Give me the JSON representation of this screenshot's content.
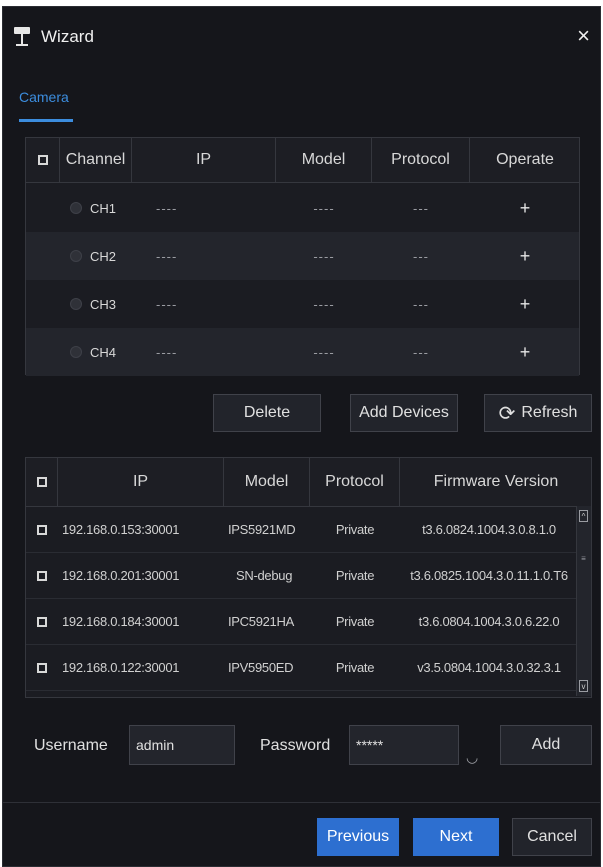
{
  "window": {
    "title": "Wizard",
    "close_label": "×"
  },
  "tab": {
    "label": "Camera"
  },
  "channels": {
    "headers": [
      "Channel",
      "IP",
      "Model",
      "Protocol",
      "Operate"
    ],
    "rows": [
      {
        "channel": "CH1",
        "ip": "----",
        "model": "----",
        "protocol": "---",
        "operate": "+"
      },
      {
        "channel": "CH2",
        "ip": "----",
        "model": "----",
        "protocol": "---",
        "operate": "+"
      },
      {
        "channel": "CH3",
        "ip": "----",
        "model": "----",
        "protocol": "---",
        "operate": "+"
      },
      {
        "channel": "CH4",
        "ip": "----",
        "model": "----",
        "protocol": "---",
        "operate": "+"
      }
    ]
  },
  "actions": {
    "delete": "Delete",
    "add_devices": "Add Devices",
    "refresh": "Refresh"
  },
  "devices": {
    "headers": [
      "IP",
      "Model",
      "Protocol",
      "Firmware Version"
    ],
    "rows": [
      {
        "ip": "192.168.0.153:30001",
        "model": "IPS5921MD",
        "protocol": "Private",
        "firmware": "t3.6.0824.1004.3.0.8.1.0"
      },
      {
        "ip": "192.168.0.201:30001",
        "model": "SN-debug",
        "protocol": "Private",
        "firmware": "t3.6.0825.1004.3.0.11.1.0.T6"
      },
      {
        "ip": "192.168.0.184:30001",
        "model": "IPC5921HA",
        "protocol": "Private",
        "firmware": "t3.6.0804.1004.3.0.6.22.0"
      },
      {
        "ip": "192.168.0.122:30001",
        "model": "IPV5950ED",
        "protocol": "Private",
        "firmware": "v3.5.0804.1004.3.0.32.3.1"
      }
    ]
  },
  "credentials": {
    "username_label": "Username",
    "username_value": "admin",
    "password_label": "Password",
    "password_value": "*****",
    "add": "Add"
  },
  "footer": {
    "previous": "Previous",
    "next": "Next",
    "cancel": "Cancel"
  },
  "colors": {
    "accent": "#3c8dde",
    "primary_button": "#2d6fd0",
    "background": "#15161b"
  }
}
